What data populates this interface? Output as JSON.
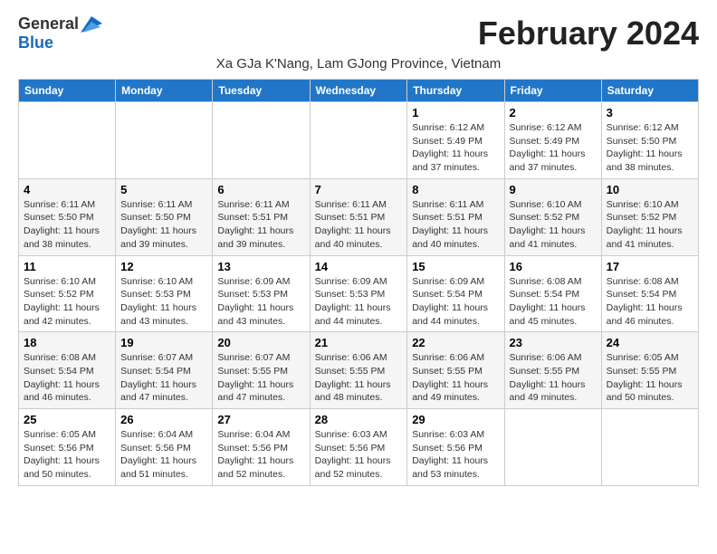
{
  "header": {
    "logo_general": "General",
    "logo_blue": "Blue",
    "month_title": "February 2024",
    "subtitle": "Xa GJa K'Nang, Lam GJong Province, Vietnam"
  },
  "weekdays": [
    "Sunday",
    "Monday",
    "Tuesday",
    "Wednesday",
    "Thursday",
    "Friday",
    "Saturday"
  ],
  "weeks": [
    [
      {
        "day": "",
        "sunrise": "",
        "sunset": "",
        "daylight": ""
      },
      {
        "day": "",
        "sunrise": "",
        "sunset": "",
        "daylight": ""
      },
      {
        "day": "",
        "sunrise": "",
        "sunset": "",
        "daylight": ""
      },
      {
        "day": "",
        "sunrise": "",
        "sunset": "",
        "daylight": ""
      },
      {
        "day": "1",
        "sunrise": "Sunrise: 6:12 AM",
        "sunset": "Sunset: 5:49 PM",
        "daylight": "Daylight: 11 hours and 37 minutes."
      },
      {
        "day": "2",
        "sunrise": "Sunrise: 6:12 AM",
        "sunset": "Sunset: 5:49 PM",
        "daylight": "Daylight: 11 hours and 37 minutes."
      },
      {
        "day": "3",
        "sunrise": "Sunrise: 6:12 AM",
        "sunset": "Sunset: 5:50 PM",
        "daylight": "Daylight: 11 hours and 38 minutes."
      }
    ],
    [
      {
        "day": "4",
        "sunrise": "Sunrise: 6:11 AM",
        "sunset": "Sunset: 5:50 PM",
        "daylight": "Daylight: 11 hours and 38 minutes."
      },
      {
        "day": "5",
        "sunrise": "Sunrise: 6:11 AM",
        "sunset": "Sunset: 5:50 PM",
        "daylight": "Daylight: 11 hours and 39 minutes."
      },
      {
        "day": "6",
        "sunrise": "Sunrise: 6:11 AM",
        "sunset": "Sunset: 5:51 PM",
        "daylight": "Daylight: 11 hours and 39 minutes."
      },
      {
        "day": "7",
        "sunrise": "Sunrise: 6:11 AM",
        "sunset": "Sunset: 5:51 PM",
        "daylight": "Daylight: 11 hours and 40 minutes."
      },
      {
        "day": "8",
        "sunrise": "Sunrise: 6:11 AM",
        "sunset": "Sunset: 5:51 PM",
        "daylight": "Daylight: 11 hours and 40 minutes."
      },
      {
        "day": "9",
        "sunrise": "Sunrise: 6:10 AM",
        "sunset": "Sunset: 5:52 PM",
        "daylight": "Daylight: 11 hours and 41 minutes."
      },
      {
        "day": "10",
        "sunrise": "Sunrise: 6:10 AM",
        "sunset": "Sunset: 5:52 PM",
        "daylight": "Daylight: 11 hours and 41 minutes."
      }
    ],
    [
      {
        "day": "11",
        "sunrise": "Sunrise: 6:10 AM",
        "sunset": "Sunset: 5:52 PM",
        "daylight": "Daylight: 11 hours and 42 minutes."
      },
      {
        "day": "12",
        "sunrise": "Sunrise: 6:10 AM",
        "sunset": "Sunset: 5:53 PM",
        "daylight": "Daylight: 11 hours and 43 minutes."
      },
      {
        "day": "13",
        "sunrise": "Sunrise: 6:09 AM",
        "sunset": "Sunset: 5:53 PM",
        "daylight": "Daylight: 11 hours and 43 minutes."
      },
      {
        "day": "14",
        "sunrise": "Sunrise: 6:09 AM",
        "sunset": "Sunset: 5:53 PM",
        "daylight": "Daylight: 11 hours and 44 minutes."
      },
      {
        "day": "15",
        "sunrise": "Sunrise: 6:09 AM",
        "sunset": "Sunset: 5:54 PM",
        "daylight": "Daylight: 11 hours and 44 minutes."
      },
      {
        "day": "16",
        "sunrise": "Sunrise: 6:08 AM",
        "sunset": "Sunset: 5:54 PM",
        "daylight": "Daylight: 11 hours and 45 minutes."
      },
      {
        "day": "17",
        "sunrise": "Sunrise: 6:08 AM",
        "sunset": "Sunset: 5:54 PM",
        "daylight": "Daylight: 11 hours and 46 minutes."
      }
    ],
    [
      {
        "day": "18",
        "sunrise": "Sunrise: 6:08 AM",
        "sunset": "Sunset: 5:54 PM",
        "daylight": "Daylight: 11 hours and 46 minutes."
      },
      {
        "day": "19",
        "sunrise": "Sunrise: 6:07 AM",
        "sunset": "Sunset: 5:54 PM",
        "daylight": "Daylight: 11 hours and 47 minutes."
      },
      {
        "day": "20",
        "sunrise": "Sunrise: 6:07 AM",
        "sunset": "Sunset: 5:55 PM",
        "daylight": "Daylight: 11 hours and 47 minutes."
      },
      {
        "day": "21",
        "sunrise": "Sunrise: 6:06 AM",
        "sunset": "Sunset: 5:55 PM",
        "daylight": "Daylight: 11 hours and 48 minutes."
      },
      {
        "day": "22",
        "sunrise": "Sunrise: 6:06 AM",
        "sunset": "Sunset: 5:55 PM",
        "daylight": "Daylight: 11 hours and 49 minutes."
      },
      {
        "day": "23",
        "sunrise": "Sunrise: 6:06 AM",
        "sunset": "Sunset: 5:55 PM",
        "daylight": "Daylight: 11 hours and 49 minutes."
      },
      {
        "day": "24",
        "sunrise": "Sunrise: 6:05 AM",
        "sunset": "Sunset: 5:55 PM",
        "daylight": "Daylight: 11 hours and 50 minutes."
      }
    ],
    [
      {
        "day": "25",
        "sunrise": "Sunrise: 6:05 AM",
        "sunset": "Sunset: 5:56 PM",
        "daylight": "Daylight: 11 hours and 50 minutes."
      },
      {
        "day": "26",
        "sunrise": "Sunrise: 6:04 AM",
        "sunset": "Sunset: 5:56 PM",
        "daylight": "Daylight: 11 hours and 51 minutes."
      },
      {
        "day": "27",
        "sunrise": "Sunrise: 6:04 AM",
        "sunset": "Sunset: 5:56 PM",
        "daylight": "Daylight: 11 hours and 52 minutes."
      },
      {
        "day": "28",
        "sunrise": "Sunrise: 6:03 AM",
        "sunset": "Sunset: 5:56 PM",
        "daylight": "Daylight: 11 hours and 52 minutes."
      },
      {
        "day": "29",
        "sunrise": "Sunrise: 6:03 AM",
        "sunset": "Sunset: 5:56 PM",
        "daylight": "Daylight: 11 hours and 53 minutes."
      },
      {
        "day": "",
        "sunrise": "",
        "sunset": "",
        "daylight": ""
      },
      {
        "day": "",
        "sunrise": "",
        "sunset": "",
        "daylight": ""
      }
    ]
  ]
}
